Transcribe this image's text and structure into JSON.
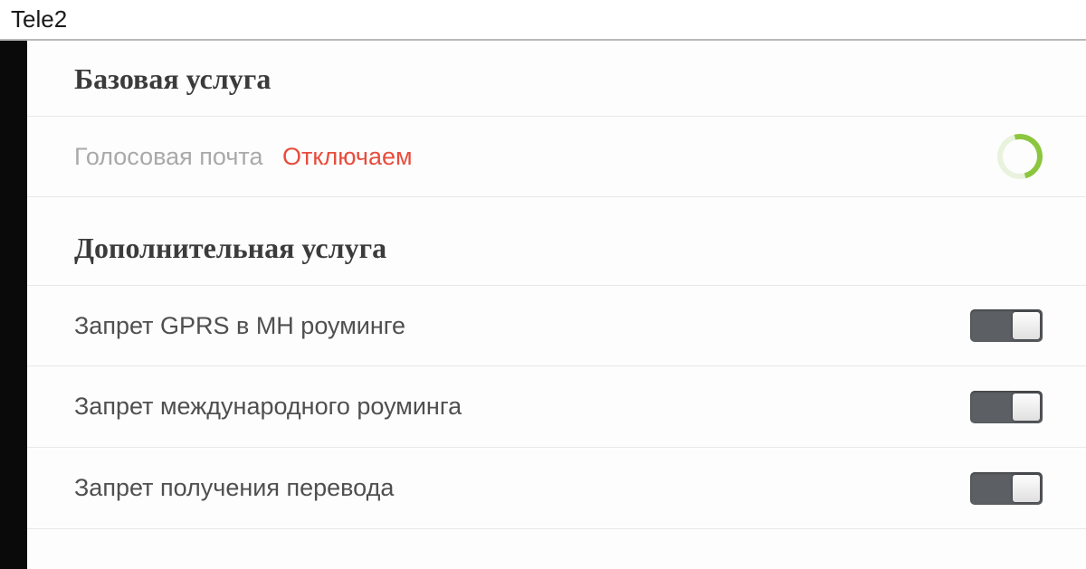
{
  "window": {
    "title": "Tele2"
  },
  "sectionBase": {
    "heading": "Базовая услуга"
  },
  "voicemail": {
    "label": "Голосовая почта",
    "status": "Отключаем"
  },
  "sectionAdditional": {
    "heading": "Дополнительная услуга"
  },
  "items": [
    {
      "label": "Запрет GPRS в МН роуминге"
    },
    {
      "label": "Запрет международного роуминга"
    },
    {
      "label": "Запрет получения перевода"
    }
  ]
}
